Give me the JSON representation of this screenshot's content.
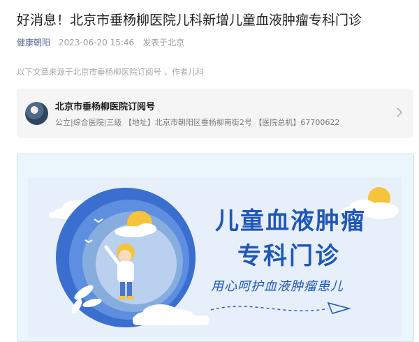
{
  "article": {
    "title": "好消息！北京市垂杨柳医院儿科新增儿童血液肿瘤专科门诊",
    "author": "健康朝阳",
    "date": "2023-06-20 15:46",
    "location": "发表于北京",
    "source_note": "以下文章来源于北京市垂杨柳医院订阅号 ，作者儿科"
  },
  "account": {
    "name": "北京市垂杨柳医院订阅号",
    "description": "公立|综合医院|三级 【地址】北京市朝阳区垂杨柳南街2号 【医院总机】67700622",
    "avatar_icon": "hospital-avatar",
    "chevron_icon": "chevron-right-icon"
  },
  "banner": {
    "title": "儿童血液肿瘤",
    "subtitle": "专科门诊",
    "slogan": "用心呵护血液肿瘤患儿",
    "colors": {
      "accent": "#1f57b8",
      "background": "#e7effb",
      "sun": "#f6c43a"
    }
  }
}
